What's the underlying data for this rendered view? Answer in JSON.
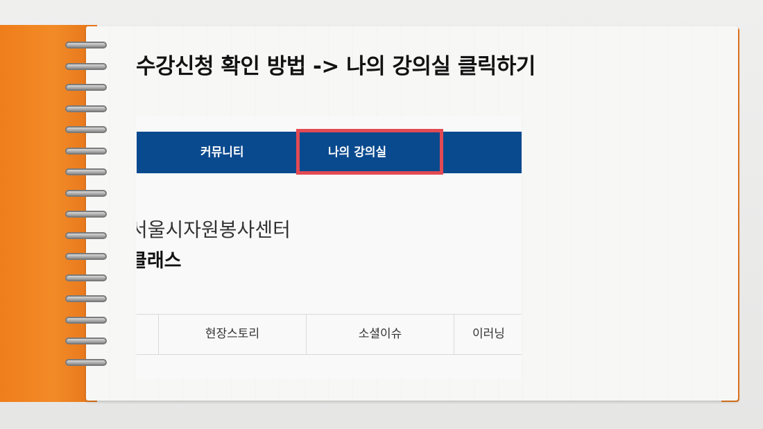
{
  "headline": "수강신청 확인 방법 -> 나의 강의실 클릭하기",
  "screenshot": {
    "nav": {
      "items": [
        "커뮤니티",
        "나의 강의실"
      ],
      "highlighted": "나의 강의실",
      "bar_color": "#094a8e",
      "highlight_color": "#e24a54"
    },
    "center_name": "서울시자원봉사센터",
    "class_name": "클래스",
    "tabs": [
      "현장스토리",
      "소셜이슈",
      "이러닝"
    ]
  },
  "colors": {
    "cover": "#f28b27",
    "paper": "#f7f7f6"
  },
  "icons": [
    "spiral-binding"
  ]
}
